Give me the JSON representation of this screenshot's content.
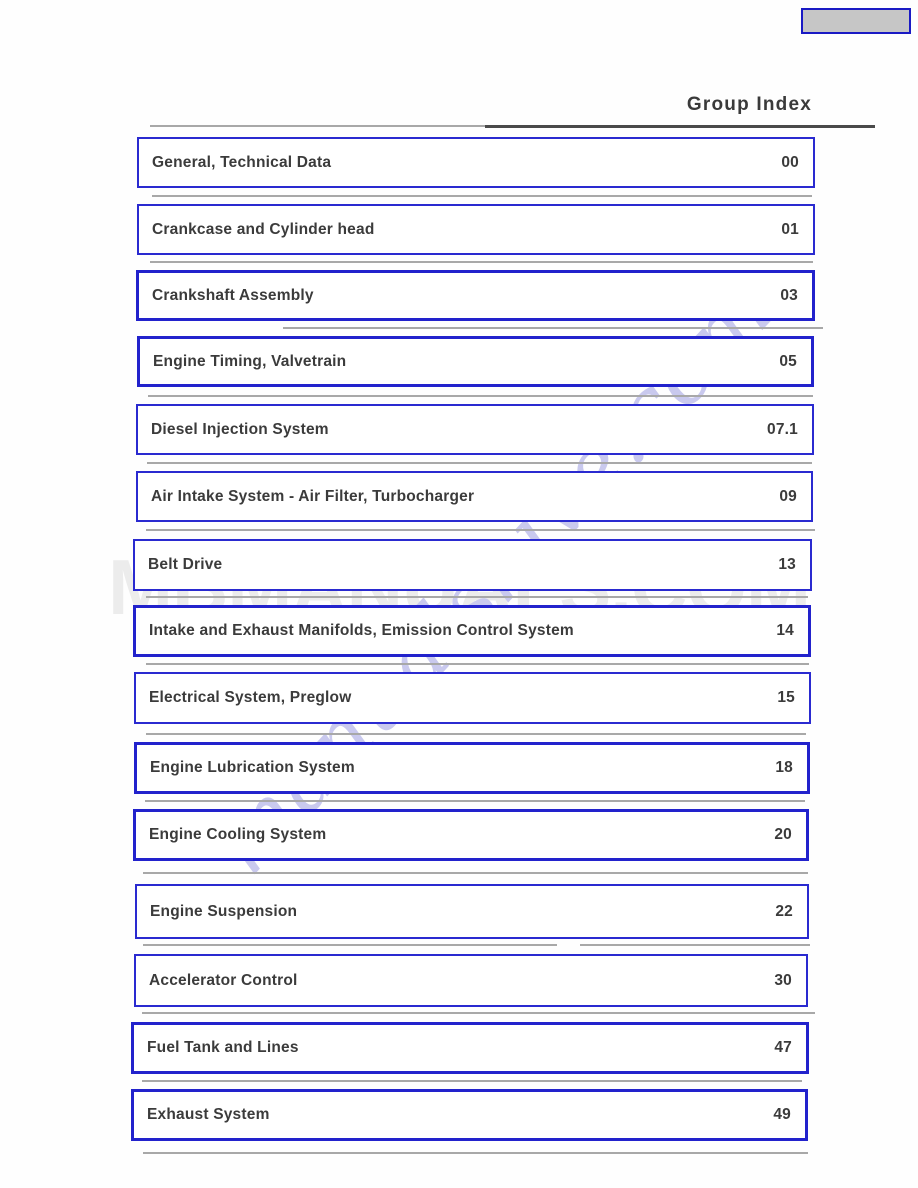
{
  "page": {
    "title": "Group Index"
  },
  "corner_box": {
    "label": "",
    "fill_color": "#c6c6c6",
    "border_color": "#1a1ac4"
  },
  "colors": {
    "row_border": "#2222cc",
    "text": "#3b3b3b",
    "rule": "#8a8a8a",
    "watermark_horizontal": "#ececec",
    "watermark_diagonal": "#c9c9ee"
  },
  "watermarks": {
    "horizontal": "MBMANUALS.COM",
    "diagonal": "manualshive.com"
  },
  "index_rows": [
    {
      "label": "General, Technical Data",
      "number": "00"
    },
    {
      "label": "Crankcase and Cylinder head",
      "number": "01"
    },
    {
      "label": "Crankshaft Assembly",
      "number": "03"
    },
    {
      "label": "Engine Timing, Valvetrain",
      "number": "05"
    },
    {
      "label": "Diesel Injection System",
      "number": "07.1"
    },
    {
      "label": "Air Intake System - Air Filter, Turbocharger",
      "number": "09"
    },
    {
      "label": "Belt Drive",
      "number": "13"
    },
    {
      "label": "Intake and Exhaust Manifolds, Emission Control System",
      "number": "14"
    },
    {
      "label": "Electrical System, Preglow",
      "number": "15"
    },
    {
      "label": "Engine Lubrication System",
      "number": "18"
    },
    {
      "label": "Engine Cooling System",
      "number": "20"
    },
    {
      "label": "Engine Suspension",
      "number": "22"
    },
    {
      "label": "Accelerator Control",
      "number": "30"
    },
    {
      "label": "Fuel Tank and Lines",
      "number": "47"
    },
    {
      "label": "Exhaust System",
      "number": "49"
    }
  ]
}
